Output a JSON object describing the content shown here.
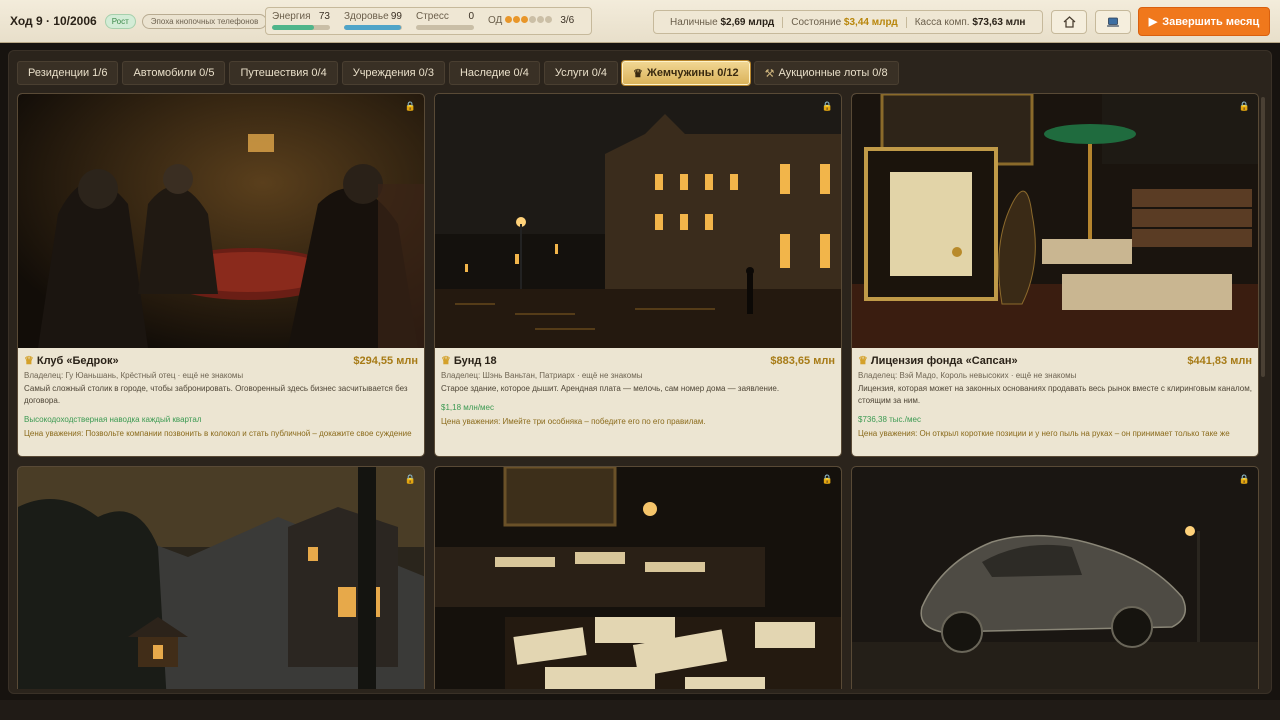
{
  "header": {
    "turn": "Ход 9 · 10/2006",
    "phase": "Рост",
    "era": "Эпоха кнопочных телефонов",
    "stats": {
      "energy_label": "Энергия",
      "energy_value": "73",
      "energy_fraction": 0.73,
      "health_label": "Здоровье",
      "health_value": "99",
      "health_fraction": 0.99,
      "stress_label": "Стресс",
      "stress_value": "0",
      "stress_fraction": 0.0
    },
    "od_label": "ОД",
    "od_count": "3/6",
    "od_filled": 3,
    "od_total": 6,
    "cash_label": "Наличные",
    "cash_value": "$2,69 млрд",
    "networth_label": "Состояние",
    "networth_value": "$3,44 млрд",
    "company_label": "Касса комп.",
    "company_value": "$73,63 млн",
    "home_icon": "house-icon",
    "computer_icon": "laptop-icon",
    "end_month_label": "Завершить месяц"
  },
  "tabs": [
    {
      "label": "Резиденции 1/6",
      "active": false
    },
    {
      "label": "Автомобили 0/5",
      "active": false
    },
    {
      "label": "Путешествия 0/4",
      "active": false
    },
    {
      "label": "Учреждения 0/3",
      "active": false
    },
    {
      "label": "Наследие 0/4",
      "active": false
    },
    {
      "label": "Услуги 0/4",
      "active": false
    },
    {
      "label": "Жемчужины 0/12",
      "active": true
    },
    {
      "label": "Аукционные лоты 0/8",
      "active": false
    }
  ],
  "cards": [
    {
      "name": "Клуб «Бедрок»",
      "price": "$294,55 млн",
      "owner": "Владелец: Гу Юаньшань, Крёстный отец · ещё не знакомы",
      "desc": "Самый сложный столик в городе, чтобы забронировать. Оговоренный здесь бизнес засчитывается без договора.",
      "perk": "Высокодоходстверная наводка каждый квартал",
      "respect": "Цена уважения: Позвольте компании позвонить в колокол и стать публичной – докажите свое суждение"
    },
    {
      "name": "Бунд 18",
      "price": "$883,65 млн",
      "owner": "Владелец: Шэнь Ваньтан, Патриарх · ещё не знакомы",
      "desc": "Старое здание, которое дышит. Арендная плата — мелочь, сам номер дома — заявление.",
      "perk": "$1,18 млн/мес",
      "respect": "Цена уважения: Имейте три особняка – победите его по его правилам."
    },
    {
      "name": "Лицензия фонда «Сапсан»",
      "price": "$441,83 млн",
      "owner": "Владелец: Вэй Мадо, Король невысоких · ещё не знакомы",
      "desc": "Лицензия, которая может на законных основаниях продавать весь рынок вместе с клиринговым каналом, стоящим за ним.",
      "perk": "$736,38 тыс./мес",
      "respect": "Цена уважения: Он открыл короткие позиции и у него пыль на руках – он принимает только таке же"
    }
  ],
  "lock_icon": "lock-icon",
  "crown_icon": "crown-icon",
  "colors": {
    "accent": "#f0781c",
    "gold": "#b8860b",
    "energy": "#4fb58a",
    "health": "#4fa4c8",
    "stress": "#b0a58e",
    "od_filled": "#e8962a",
    "od_empty": "#cbbfa6"
  }
}
